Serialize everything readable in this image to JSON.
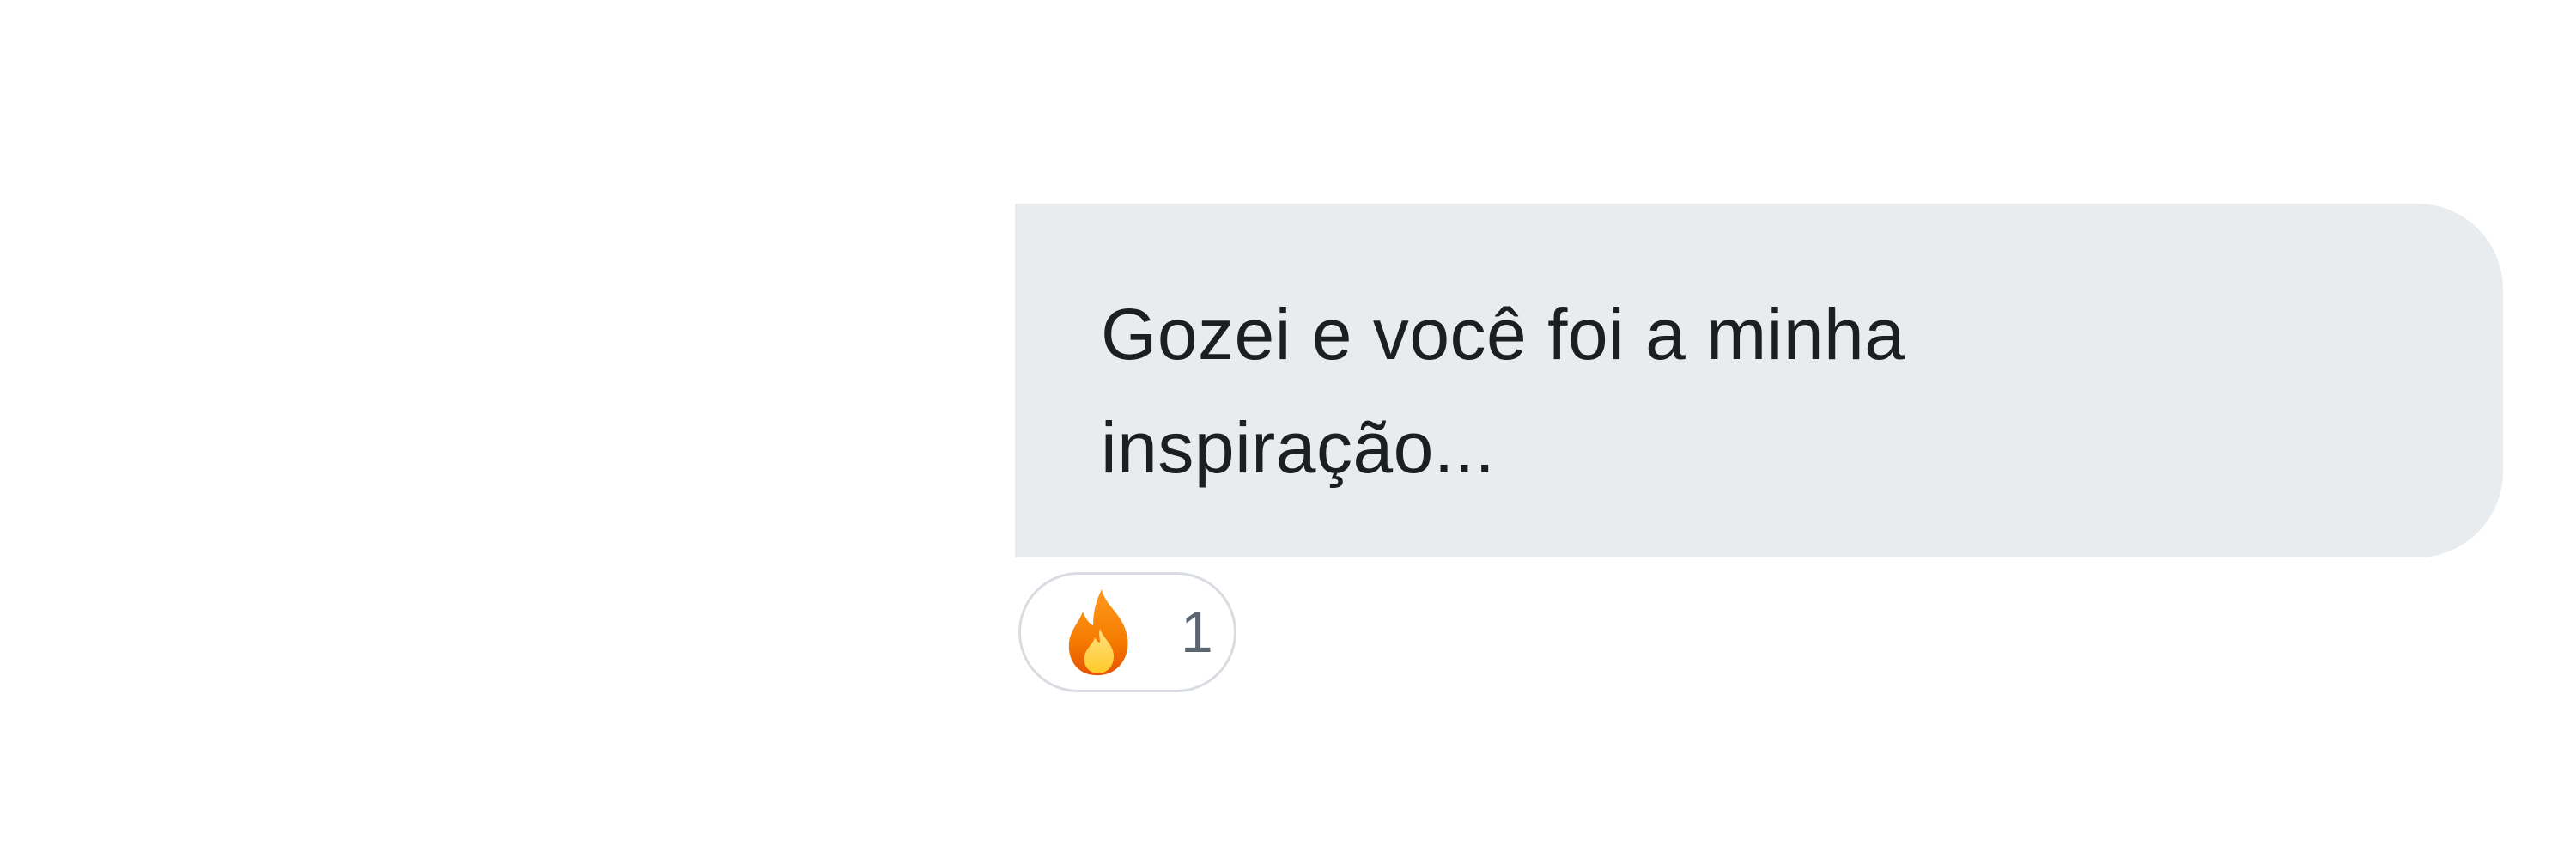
{
  "message": {
    "text": "Gozei e você foi a minha\ninspiração...",
    "bubble_color": "#e9ecef",
    "text_color": "#1c1e21"
  },
  "reaction": {
    "icon": "fire-icon",
    "emoji": "🔥",
    "count": "1",
    "count_color": "#5c6670",
    "border_color": "#d9dde2"
  }
}
